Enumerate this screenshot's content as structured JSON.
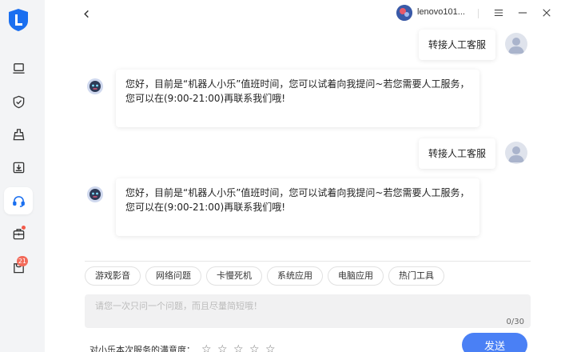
{
  "header": {
    "user_name": "lenovo101..."
  },
  "sidebar": {
    "items": [
      {
        "icon": "laptop-icon"
      },
      {
        "icon": "shield-check-icon"
      },
      {
        "icon": "cleanup-icon"
      },
      {
        "icon": "download-box-icon"
      },
      {
        "icon": "headset-icon",
        "active": true
      },
      {
        "icon": "toolbox-icon",
        "badge_dot": true
      },
      {
        "icon": "cart-icon",
        "badge": "21"
      }
    ]
  },
  "messages": [
    {
      "from": "user",
      "text": "转接人工客服"
    },
    {
      "from": "bot",
      "line1": "您好，目前是“机器人小乐”值班时间，您可以试着向我提问~若您需要人工服务，",
      "line2": "您可以在(9:00-21:00)再联系我们哦!"
    },
    {
      "from": "user",
      "text": "转接人工客服"
    },
    {
      "from": "bot",
      "line1": "您好，目前是“机器人小乐”值班时间，您可以试着向我提问~若您需要人工服务，",
      "line2": "您可以在(9:00-21:00)再联系我们哦!"
    }
  ],
  "quick_topics": [
    "游戏影音",
    "网络问题",
    "卡慢死机",
    "系统应用",
    "电脑应用",
    "热门工具"
  ],
  "input": {
    "placeholder": "请您一次只问一个问题，而且尽量简短哦！",
    "value": "",
    "counter": "0/30"
  },
  "rating": {
    "label": "对小乐本次服务的满意度：",
    "stars_total": 5,
    "stars_selected": 0
  },
  "send_label": "发送",
  "colors": {
    "accent": "#4a80f5",
    "brand": "#1a6ff0",
    "badge": "#f25a4a"
  }
}
